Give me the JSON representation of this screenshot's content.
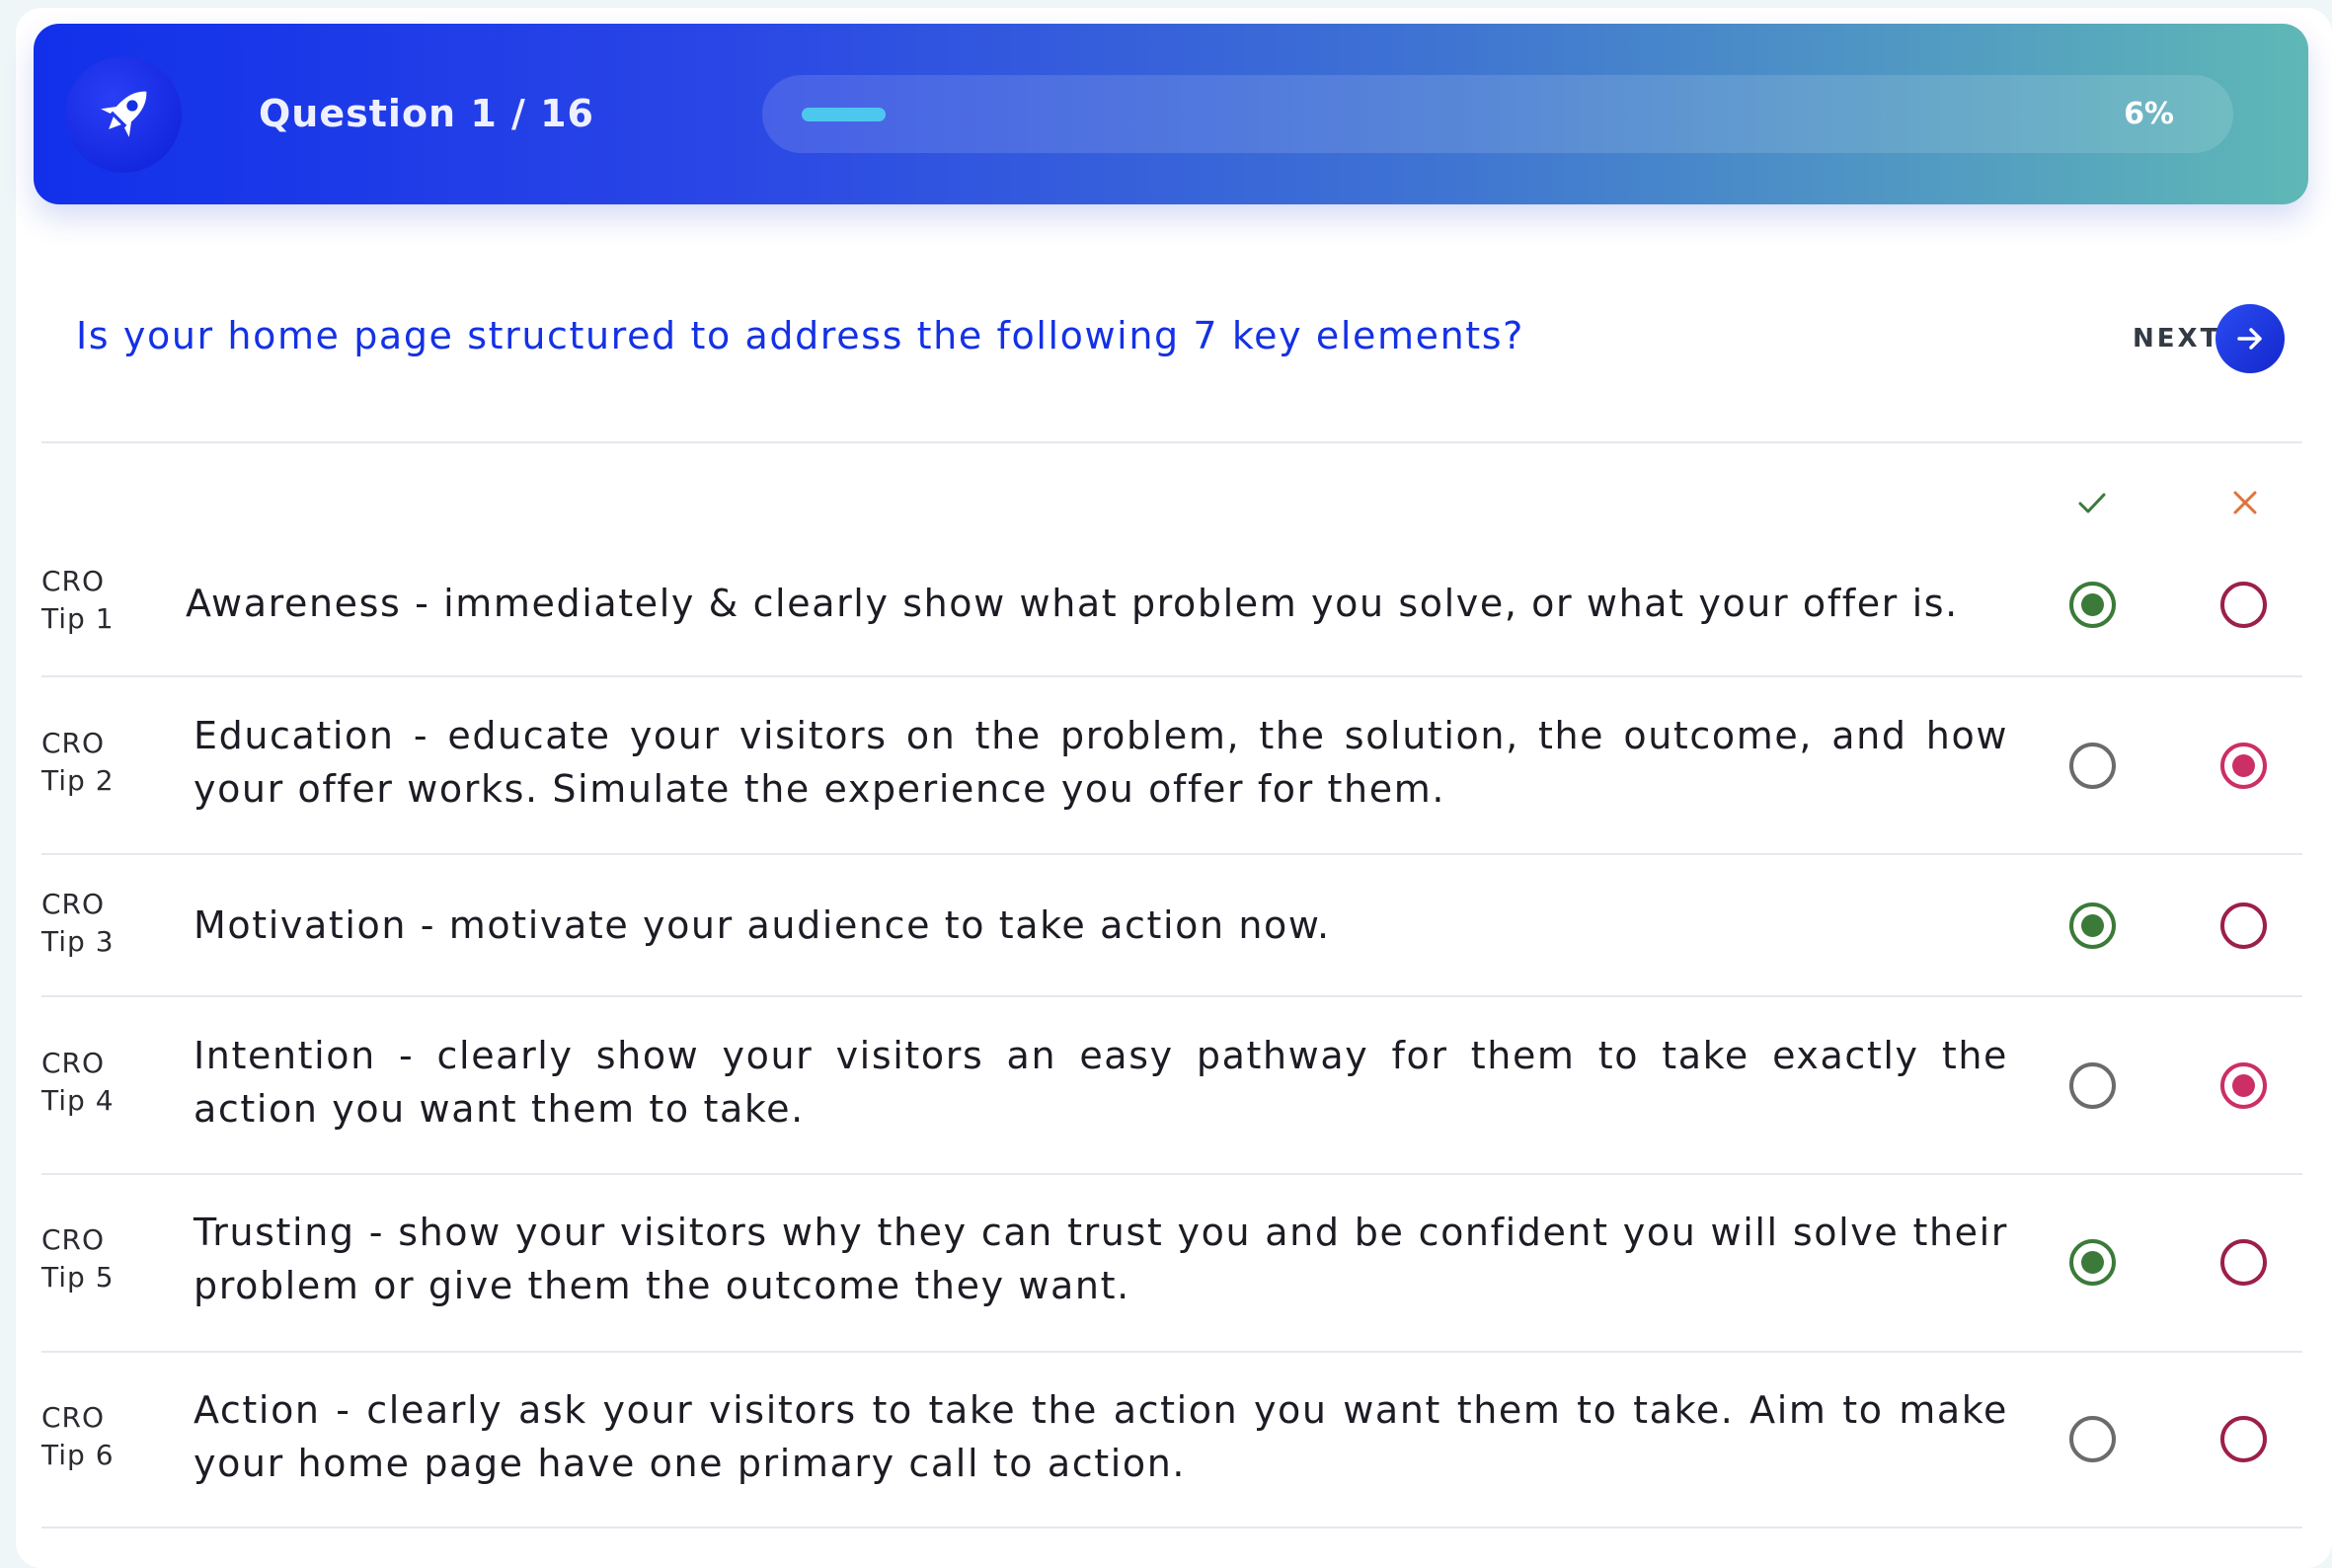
{
  "header": {
    "logo_icon": "rocket-icon",
    "question_counter": "Question 1 / 16",
    "progress_percent_label": "6%",
    "progress_fraction": 0.06
  },
  "question": {
    "text": "Is your home page structured to address the following 7 key elements?",
    "next_label": "NEXT",
    "next_icon": "arrow-right-icon"
  },
  "columns": {
    "yes_icon": "check-icon",
    "no_icon": "cross-icon",
    "yes_color": "#3b7a39",
    "no_color": "#cc2e66"
  },
  "rows": [
    {
      "tip_line1": "CRO",
      "tip_line2": "Tip 1",
      "text": "Awareness - immediately & clearly show what problem you solve, or what your offer is.",
      "selected": "yes"
    },
    {
      "tip_line1": "CRO",
      "tip_line2": "Tip 2",
      "text": "Education - educate your visitors on the problem, the solution, the outcome, and how your offer works. Simulate the experience you offer for them.",
      "selected": "no"
    },
    {
      "tip_line1": "CRO",
      "tip_line2": "Tip 3",
      "text": "Motivation - motivate your audience to take action now.",
      "selected": "yes"
    },
    {
      "tip_line1": "CRO",
      "tip_line2": "Tip 4",
      "text": "Intention - clearly show your visitors an easy pathway for them to take exactly the action you want them to take.",
      "selected": "no"
    },
    {
      "tip_line1": "CRO",
      "tip_line2": "Tip 5",
      "text": "Trusting - show your visitors why they can trust you and be confident you will solve their problem or give them the outcome they want.",
      "selected": "yes"
    },
    {
      "tip_line1": "CRO",
      "tip_line2": "Tip 6",
      "text": "Action - clearly ask your visitors to take the action you want them to take. Aim to make your home page have one primary call to action.",
      "selected": "none"
    }
  ]
}
